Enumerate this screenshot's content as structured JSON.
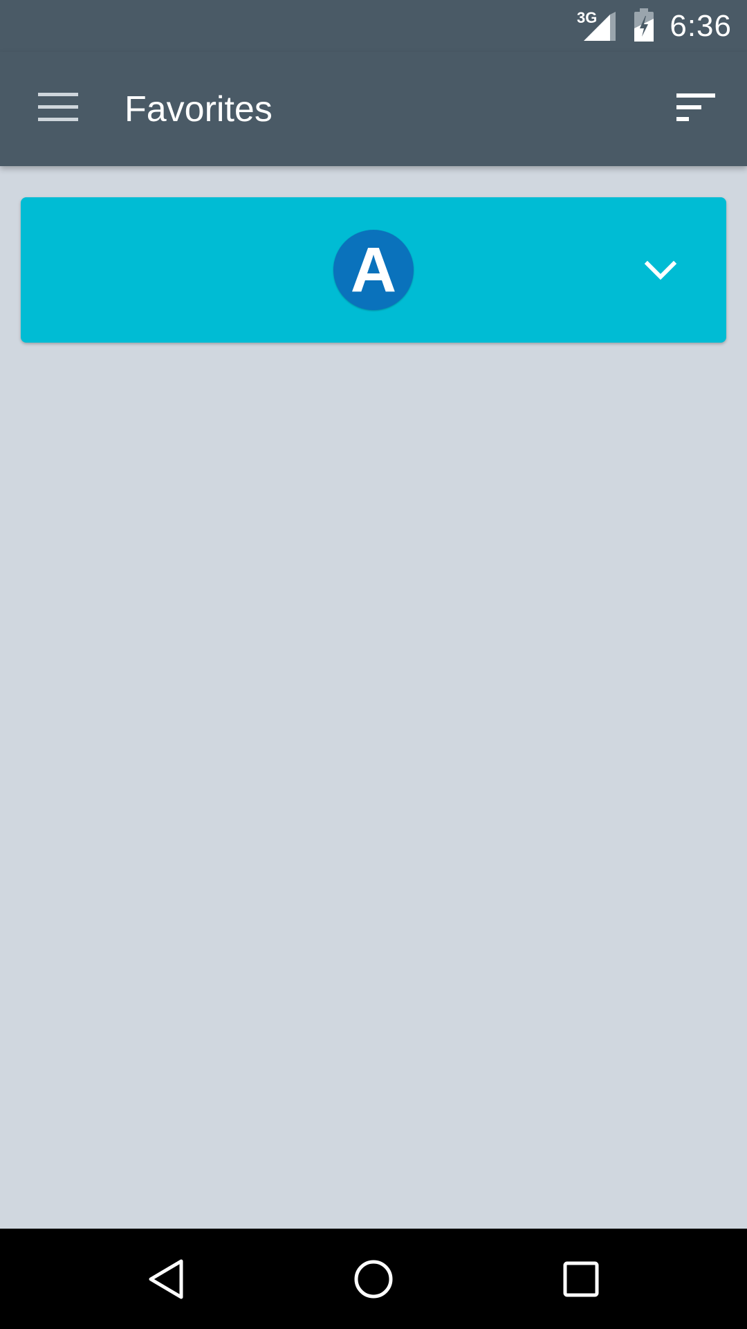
{
  "status_bar": {
    "network_label": "3G",
    "time": "6:36"
  },
  "app_bar": {
    "title": "Favorites",
    "menu_icon": "hamburger-menu-icon",
    "sort_icon": "sort-icon"
  },
  "favorites": [
    {
      "line_letter": "A",
      "badge_color": "#0a72bc",
      "card_color": "#00bcd4",
      "expand_icon": "chevron-down-icon"
    }
  ],
  "nav_bar": {
    "back_icon": "back-triangle-icon",
    "home_icon": "home-circle-icon",
    "recents_icon": "recents-square-icon"
  },
  "colors": {
    "app_bar": "#4a5a66",
    "background": "#d0d7df",
    "nav_bar": "#000000"
  }
}
